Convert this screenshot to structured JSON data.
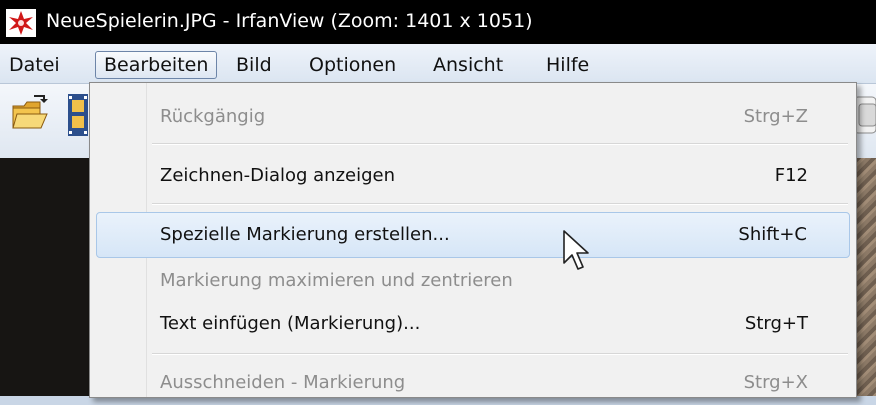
{
  "window": {
    "title": "NeueSpielerin.JPG - IrfanView (Zoom: 1401 x 1051)",
    "icon": "irfanview-app-icon"
  },
  "menubar": {
    "items": [
      "Datei",
      "Bearbeiten",
      "Bild",
      "Optionen",
      "Ansicht",
      "Hilfe"
    ],
    "active": "Bearbeiten"
  },
  "toolbar": {
    "icons": [
      "open-folder-icon",
      "filmstrip-icon",
      "toolbar-button-icon"
    ]
  },
  "dropdown": {
    "items": [
      {
        "label": "Rückgängig",
        "shortcut": "Strg+Z",
        "enabled": false
      },
      {
        "label": "Zeichnen-Dialog anzeigen",
        "shortcut": "F12",
        "enabled": true
      },
      {
        "label": "Spezielle Markierung erstellen...",
        "shortcut": "Shift+C",
        "enabled": true,
        "highlighted": true
      },
      {
        "label": "Markierung maximieren und zentrieren",
        "shortcut": "",
        "enabled": false
      },
      {
        "label": "Text einfügen (Markierung)...",
        "shortcut": "Strg+T",
        "enabled": true
      },
      {
        "label": "Ausschneiden - Markierung",
        "shortcut": "Strg+X",
        "enabled": false
      }
    ]
  },
  "colors": {
    "titlebar": "#000000",
    "highlight": "#d6e6f7",
    "disabled_text": "#8d8d8d"
  }
}
